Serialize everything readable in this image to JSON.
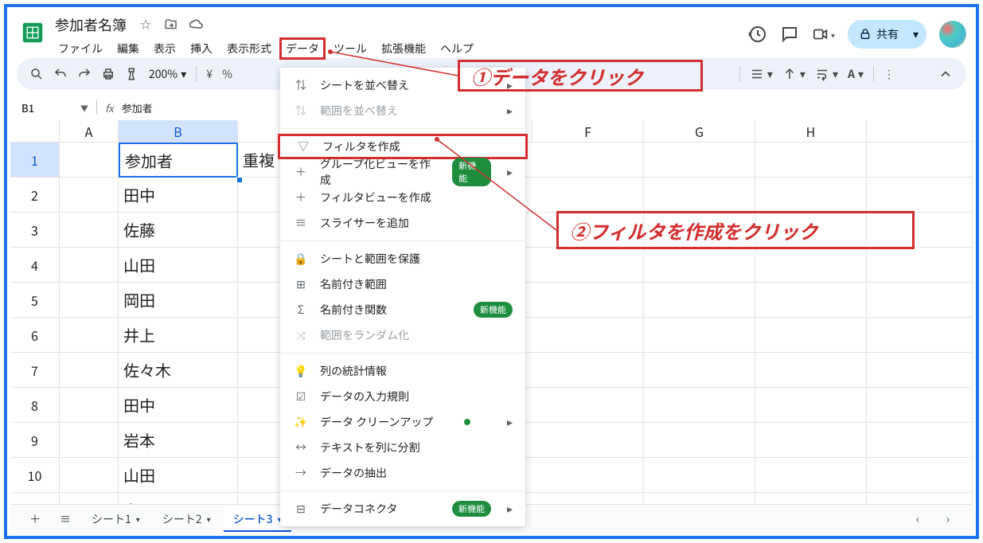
{
  "doc": {
    "title": "参加者名簿"
  },
  "menus": {
    "file": "ファイル",
    "edit": "編集",
    "view": "表示",
    "insert": "挿入",
    "format": "表示形式",
    "data": "データ",
    "tools": "ツール",
    "extensions": "拡張機能",
    "help": "ヘルプ"
  },
  "share": {
    "label": "共有"
  },
  "toolbar": {
    "zoom": "200%",
    "currency": "¥",
    "percent": "%"
  },
  "fxbar": {
    "cell": "B1",
    "fx": "fx",
    "value": "参加者"
  },
  "cols": {
    "A": "A",
    "B": "B",
    "F": "F",
    "G": "G",
    "H": "H"
  },
  "cells": {
    "b1": "参加者",
    "c1": "重複",
    "b2": "田中",
    "b3": "佐藤",
    "b4": "山田",
    "b5": "岡田",
    "b6": "井上",
    "b7": "佐々木",
    "b8": "田中",
    "b9": "岩本",
    "b10": "山田",
    "b11": "上野"
  },
  "dropdown": {
    "sort_sheet": "シートを並べ替え",
    "sort_range": "範囲を並べ替え",
    "create_filter": "フィルタを作成",
    "group_view": "グループ化ビューを作成",
    "filter_view": "フィルタビューを作成",
    "slicer": "スライサーを追加",
    "protect": "シートと範囲を保護",
    "named_range": "名前付き範囲",
    "named_func": "名前付き関数",
    "randomize": "範囲をランダム化",
    "col_stats": "列の統計情報",
    "validation": "データの入力規則",
    "cleanup": "データ クリーンアップ",
    "split": "テキストを列に分割",
    "extract": "データの抽出",
    "connector": "データコネクタ",
    "badge": "新機能"
  },
  "annotations": {
    "a1": "①データをクリック",
    "a2": "②フィルタを作成をクリック"
  },
  "tabs": {
    "s1": "シート1",
    "s2": "シート2",
    "s3": "シート3"
  }
}
